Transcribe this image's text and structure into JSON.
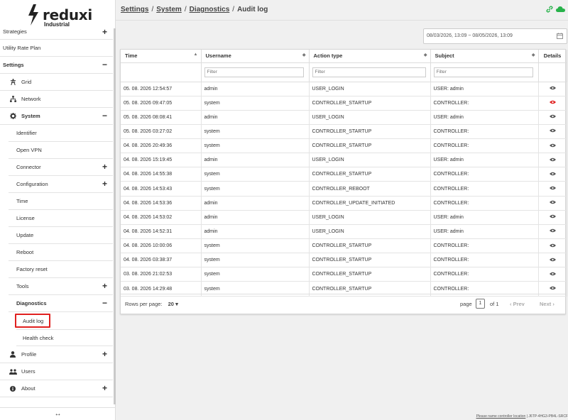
{
  "brand": {
    "name": "reduxi",
    "sub": "Industrial"
  },
  "sidebar": {
    "items": [
      {
        "label": "Strategies",
        "toggle": "+"
      },
      {
        "label": "Utility Rate Plan"
      },
      {
        "label": "Settings",
        "toggle": "−"
      },
      {
        "label": "Grid"
      },
      {
        "label": "Network"
      },
      {
        "label": "System",
        "toggle": "−"
      },
      {
        "label": "Identifier"
      },
      {
        "label": "Open VPN"
      },
      {
        "label": "Connector",
        "toggle": "+"
      },
      {
        "label": "Configuration",
        "toggle": "+"
      },
      {
        "label": "Time"
      },
      {
        "label": "License"
      },
      {
        "label": "Update"
      },
      {
        "label": "Reboot"
      },
      {
        "label": "Factory reset"
      },
      {
        "label": "Tools",
        "toggle": "+"
      },
      {
        "label": "Diagnostics",
        "toggle": "−"
      },
      {
        "label": "Audit log"
      },
      {
        "label": "Health check"
      },
      {
        "label": "Profile",
        "toggle": "+"
      },
      {
        "label": "Users"
      },
      {
        "label": "About",
        "toggle": "+"
      }
    ],
    "collapse_glyph": "↔"
  },
  "breadcrumb": {
    "b1": "Settings",
    "b2": "System",
    "b3": "Diagnostics",
    "current": "Audit log",
    "sep": "/"
  },
  "date_range": "08/03/2026, 13:09 ~ 08/05/2026, 13:09",
  "table": {
    "columns": [
      "Time",
      "Username",
      "Action type",
      "Subject",
      "Details"
    ],
    "filter_placeholder": "Filter",
    "rows": [
      {
        "time": "05. 08. 2026 12:54:57",
        "user": "admin",
        "action": "USER_LOGIN",
        "subject": "USER: admin",
        "highlight": false
      },
      {
        "time": "05. 08. 2026 09:47:05",
        "user": "system",
        "action": "CONTROLLER_STARTUP",
        "subject": "CONTROLLER:",
        "highlight": true
      },
      {
        "time": "05. 08. 2026 08:08:41",
        "user": "admin",
        "action": "USER_LOGIN",
        "subject": "USER: admin",
        "highlight": false
      },
      {
        "time": "05. 08. 2026 03:27:02",
        "user": "system",
        "action": "CONTROLLER_STARTUP",
        "subject": "CONTROLLER:",
        "highlight": false
      },
      {
        "time": "04. 08. 2026 20:49:36",
        "user": "system",
        "action": "CONTROLLER_STARTUP",
        "subject": "CONTROLLER:",
        "highlight": false
      },
      {
        "time": "04. 08. 2026 15:19:45",
        "user": "admin",
        "action": "USER_LOGIN",
        "subject": "USER: admin",
        "highlight": false
      },
      {
        "time": "04. 08. 2026 14:55:38",
        "user": "system",
        "action": "CONTROLLER_STARTUP",
        "subject": "CONTROLLER:",
        "highlight": false
      },
      {
        "time": "04. 08. 2026 14:53:43",
        "user": "system",
        "action": "CONTROLLER_REBOOT",
        "subject": "CONTROLLER:",
        "highlight": false
      },
      {
        "time": "04. 08. 2026 14:53:36",
        "user": "admin",
        "action": "CONTROLLER_UPDATE_INITIATED",
        "subject": "CONTROLLER:",
        "highlight": false
      },
      {
        "time": "04. 08. 2026 14:53:02",
        "user": "admin",
        "action": "USER_LOGIN",
        "subject": "USER: admin",
        "highlight": false
      },
      {
        "time": "04. 08. 2026 14:52:31",
        "user": "admin",
        "action": "USER_LOGIN",
        "subject": "USER: admin",
        "highlight": false
      },
      {
        "time": "04. 08. 2026 10:00:06",
        "user": "system",
        "action": "CONTROLLER_STARTUP",
        "subject": "CONTROLLER:",
        "highlight": false
      },
      {
        "time": "04. 08. 2026 03:38:37",
        "user": "system",
        "action": "CONTROLLER_STARTUP",
        "subject": "CONTROLLER:",
        "highlight": false
      },
      {
        "time": "03. 08. 2026 21:02:53",
        "user": "system",
        "action": "CONTROLLER_STARTUP",
        "subject": "CONTROLLER:",
        "highlight": false
      },
      {
        "time": "03. 08. 2026 14:29:48",
        "user": "system",
        "action": "CONTROLLER_STARTUP",
        "subject": "CONTROLLER:",
        "highlight": false
      }
    ]
  },
  "pager": {
    "rows_per_page_label": "Rows per page:",
    "rows_per_page": "20",
    "page_label": "page",
    "page": "1",
    "of": "of 1",
    "prev": "Prev",
    "next": "Next"
  },
  "footer": {
    "link": "Please name controller location",
    "rest": " | J6TP-4HG3-PB4L-SRCF"
  },
  "colors": {
    "accent_red": "#e0201f",
    "green": "#27b24a"
  }
}
